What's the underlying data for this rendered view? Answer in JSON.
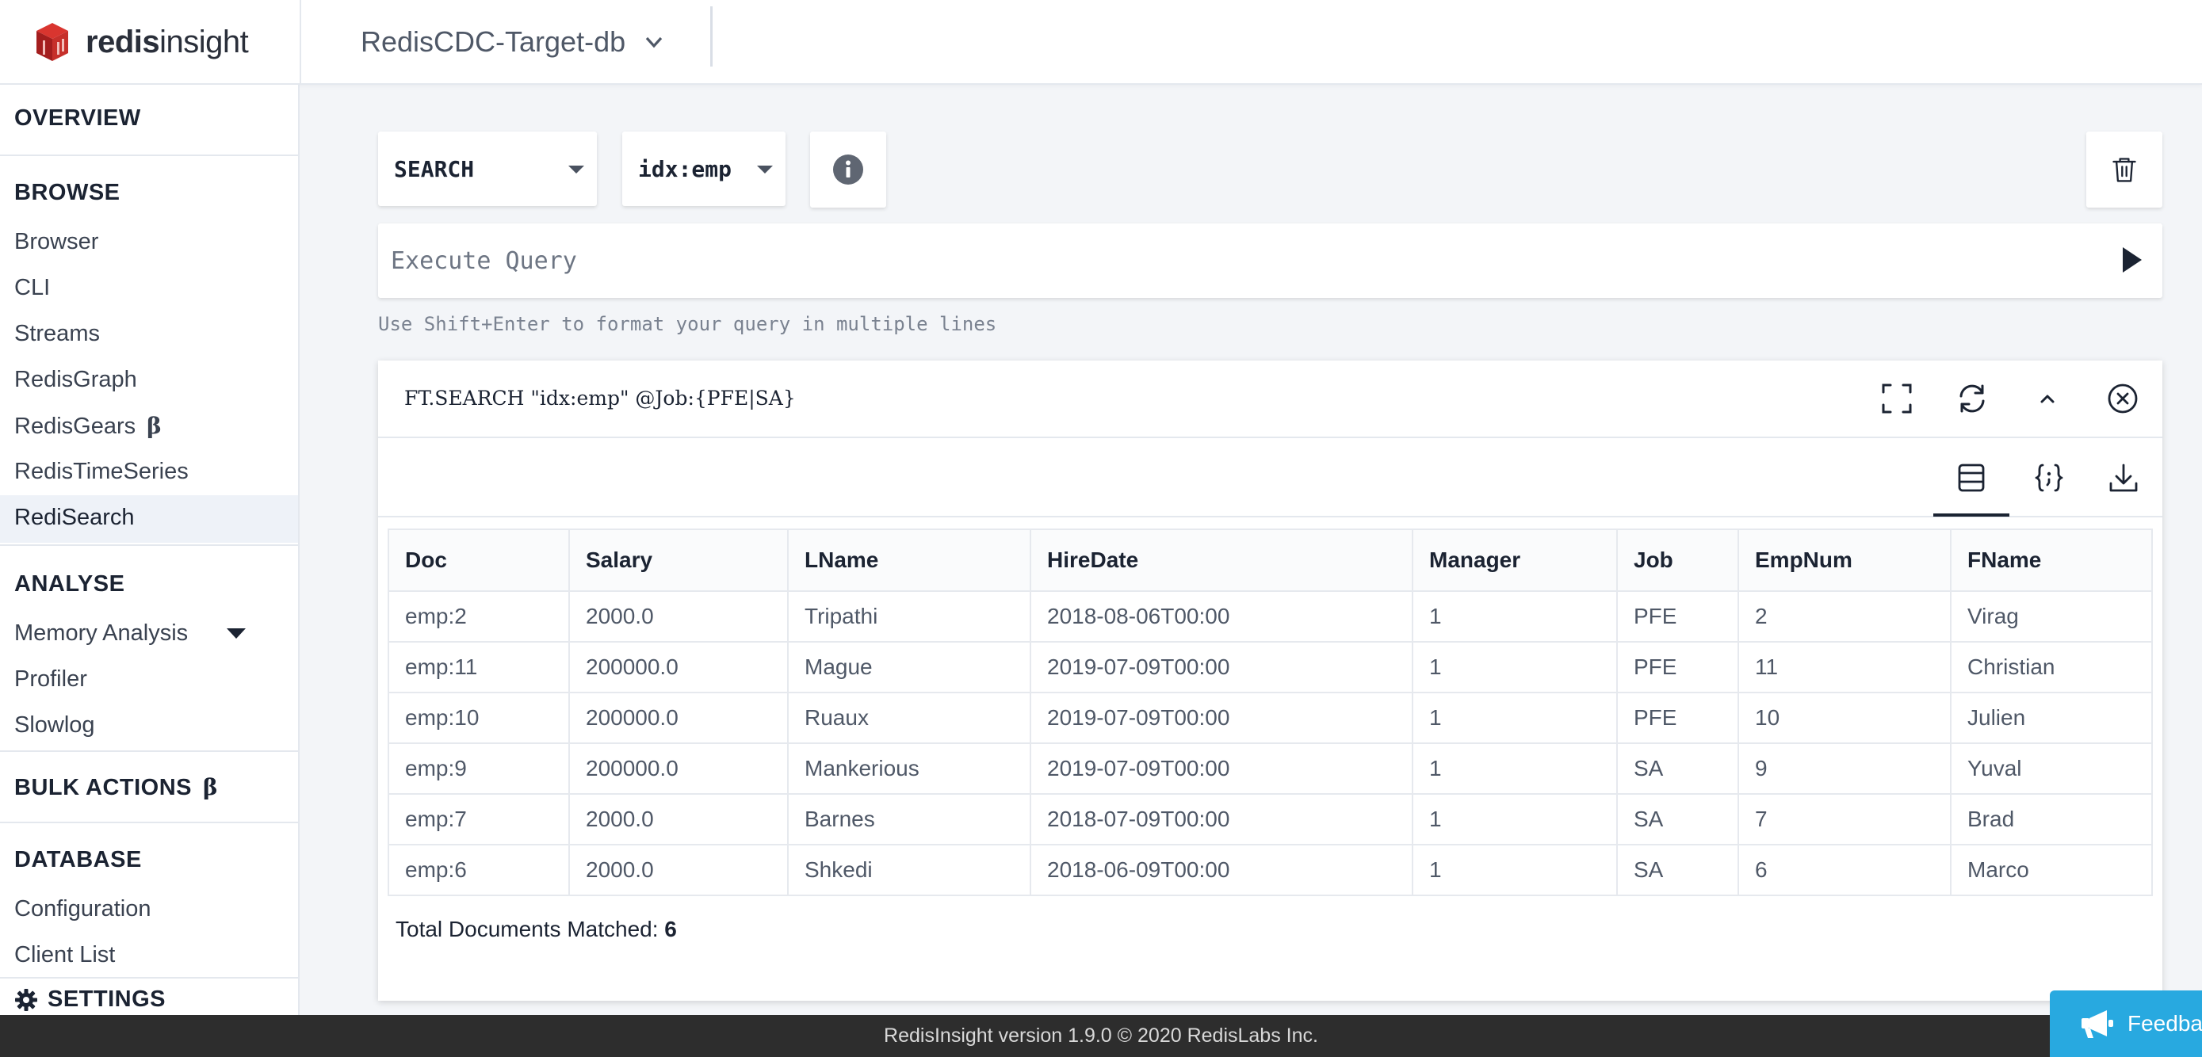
{
  "app": {
    "logo_text_bold": "redis",
    "logo_text_light": "insight",
    "database_name": "RedisCDC-Target-db"
  },
  "sidebar": {
    "overview": "OVERVIEW",
    "browse": "BROWSE",
    "browse_items": [
      "Browser",
      "CLI",
      "Streams",
      "RedisGraph",
      "RedisGears",
      "RedisTimeSeries",
      "RediSearch"
    ],
    "analyse": "ANALYSE",
    "analyse_items": [
      "Memory Analysis",
      "Profiler",
      "Slowlog"
    ],
    "bulk_actions": "BULK ACTIONS",
    "database": "DATABASE",
    "database_items": [
      "Configuration",
      "Client List"
    ],
    "settings": "SETTINGS",
    "beta_symbol": "β",
    "active_item": "RediSearch"
  },
  "query": {
    "command_select": "SEARCH",
    "index_select": "idx:emp",
    "input_value": "",
    "input_placeholder": "Execute Query",
    "hint": "Use Shift+Enter to format your query in multiple lines"
  },
  "result": {
    "command": "FT.SEARCH \"idx:emp\" @Job:{PFE|SA}",
    "columns": [
      "Doc",
      "Salary",
      "LName",
      "HireDate",
      "Manager",
      "Job",
      "EmpNum",
      "FName"
    ],
    "rows": [
      [
        "emp:2",
        "2000.0",
        "Tripathi",
        "2018-08-06T00:00",
        "1",
        "PFE",
        "2",
        "Virag"
      ],
      [
        "emp:11",
        "200000.0",
        "Mague",
        "2019-07-09T00:00",
        "1",
        "PFE",
        "11",
        "Christian"
      ],
      [
        "emp:10",
        "200000.0",
        "Ruaux",
        "2019-07-09T00:00",
        "1",
        "PFE",
        "10",
        "Julien"
      ],
      [
        "emp:9",
        "200000.0",
        "Mankerious",
        "2019-07-09T00:00",
        "1",
        "SA",
        "9",
        "Yuval"
      ],
      [
        "emp:7",
        "2000.0",
        "Barnes",
        "2018-07-09T00:00",
        "1",
        "SA",
        "7",
        "Brad"
      ],
      [
        "emp:6",
        "2000.0",
        "Shkedi",
        "2018-06-09T00:00",
        "1",
        "SA",
        "6",
        "Marco"
      ]
    ],
    "total_label": "Total Documents Matched:",
    "total_count": "6"
  },
  "footer": {
    "version_text": "RedisInsight version 1.9.0 © 2020 RedisLabs Inc.",
    "feedback_label": "Feedback"
  },
  "colors": {
    "brand_red": "#c6302b",
    "feedback_blue": "#28a9e0",
    "footer_bg": "#2d2d2d"
  },
  "icons": {
    "logo": "redis-cube-icon",
    "db_dropdown": "chevron-down-icon",
    "info": "info-icon",
    "delete": "trash-icon",
    "run": "play-icon",
    "fullscreen": "fullscreen-icon",
    "refresh": "refresh-icon",
    "collapse": "chevron-up-icon",
    "close": "close-circle-icon",
    "table_view": "table-view-icon",
    "json_view": "json-braces-icon",
    "download": "download-icon",
    "settings": "gear-icon",
    "feedback": "megaphone-icon"
  }
}
